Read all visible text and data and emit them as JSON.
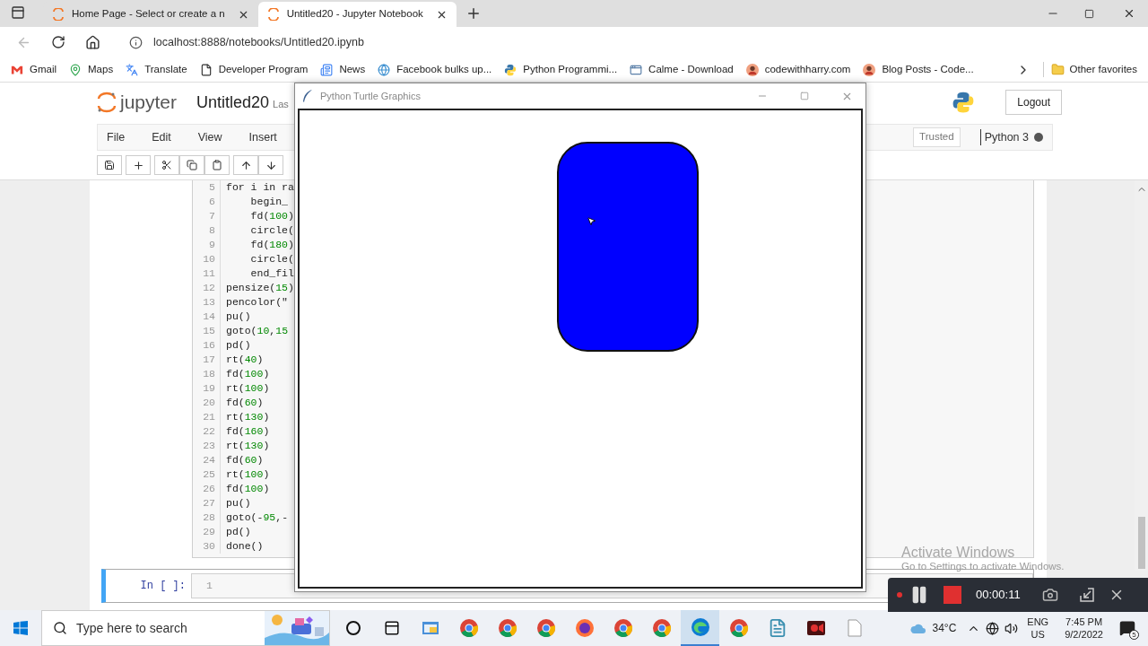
{
  "browser": {
    "tabs": [
      {
        "label": "Home Page - Select or create a n",
        "selected": false
      },
      {
        "label": "Untitled20 - Jupyter Notebook",
        "selected": true
      }
    ],
    "address": "localhost:8888/notebooks/Untitled20.ipynb",
    "bookmarks": [
      {
        "label": "Gmail",
        "kind": "mail"
      },
      {
        "label": "Maps",
        "kind": "pin"
      },
      {
        "label": "Translate",
        "kind": "translate"
      },
      {
        "label": "Developer Program",
        "kind": "page"
      },
      {
        "label": "News",
        "kind": "news"
      },
      {
        "label": "Facebook bulks up...",
        "kind": "globe"
      },
      {
        "label": "Python Programmi...",
        "kind": "snake"
      },
      {
        "label": "Calme - Download",
        "kind": "app"
      },
      {
        "label": "codewithharry.com",
        "kind": "avatar"
      },
      {
        "label": "Blog Posts - Code...",
        "kind": "avatar"
      }
    ],
    "other_favorites": "Other favorites"
  },
  "jupyter": {
    "logo": "jupyter",
    "title": "Untitled20",
    "checkpoint": "Las",
    "logout": "Logout",
    "menu": [
      "File",
      "Edit",
      "View",
      "Insert"
    ],
    "trusted": "Trusted",
    "kernel": "Python 3",
    "kernel_busy": true,
    "code_cell": {
      "lines": [
        {
          "number": "5",
          "code": "for i in ra"
        },
        {
          "number": "6",
          "code": "    begin_"
        },
        {
          "number": "7",
          "code": "    fd(100)"
        },
        {
          "number": "8",
          "code": "    circle("
        },
        {
          "number": "9",
          "code": "    fd(180)"
        },
        {
          "number": "10",
          "code": "    circle("
        },
        {
          "number": "11",
          "code": "    end_fil"
        },
        {
          "number": "12",
          "code": "pensize(15)"
        },
        {
          "number": "13",
          "code": "pencolor(\""
        },
        {
          "number": "14",
          "code": "pu()"
        },
        {
          "number": "15",
          "code": "goto(10,15"
        },
        {
          "number": "16",
          "code": "pd()"
        },
        {
          "number": "17",
          "code": "rt(40)"
        },
        {
          "number": "18",
          "code": "fd(100)"
        },
        {
          "number": "19",
          "code": "rt(100)"
        },
        {
          "number": "20",
          "code": "fd(60)"
        },
        {
          "number": "21",
          "code": "rt(130)"
        },
        {
          "number": "22",
          "code": "fd(160)"
        },
        {
          "number": "23",
          "code": "rt(130)"
        },
        {
          "number": "24",
          "code": "fd(60)"
        },
        {
          "number": "25",
          "code": "rt(100)"
        },
        {
          "number": "26",
          "code": "fd(100)"
        },
        {
          "number": "27",
          "code": "pu()"
        },
        {
          "number": "28",
          "code": "goto(-95,-"
        },
        {
          "number": "29",
          "code": "pd()"
        },
        {
          "number": "30",
          "code": "done()"
        }
      ]
    },
    "empty_cell": {
      "prompt": "In [ ]:",
      "line_number": "1",
      "selected": true
    }
  },
  "turtle_window": {
    "title": "Python Turtle Graphics"
  },
  "recorder": {
    "recording": true,
    "time": "00:00:11"
  },
  "activation": {
    "title": "Activate Windows",
    "message": "Go to Settings to activate Windows."
  },
  "taskbar": {
    "search_placeholder": "Type here to search",
    "apps": [
      {
        "kind": "cortana",
        "selected": false
      },
      {
        "kind": "taskview",
        "selected": false
      },
      {
        "kind": "python",
        "selected": false
      },
      {
        "kind": "chrome",
        "selected": false
      },
      {
        "kind": "chrome",
        "selected": false
      },
      {
        "kind": "chrome",
        "selected": false
      },
      {
        "kind": "firefox",
        "selected": false
      },
      {
        "kind": "chrome",
        "selected": false
      },
      {
        "kind": "chrome",
        "selected": false
      },
      {
        "kind": "edge",
        "selected": true
      },
      {
        "kind": "chrome",
        "selected": false
      },
      {
        "kind": "notepad",
        "selected": false
      },
      {
        "kind": "recorder",
        "selected": false
      },
      {
        "kind": "file",
        "selected": false
      }
    ],
    "temperature": "34°C",
    "language": "ENG",
    "region": "US",
    "time": "7:45 PM",
    "date": "9/2/2022",
    "notifications": "5"
  }
}
